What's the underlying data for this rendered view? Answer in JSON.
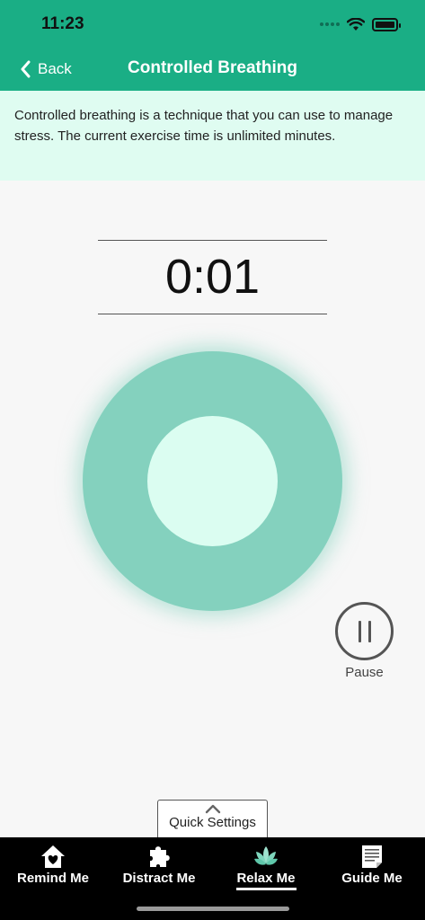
{
  "status_bar": {
    "time": "11:23"
  },
  "nav": {
    "back_label": "Back",
    "title": "Controlled Breathing"
  },
  "info": {
    "text": "Controlled breathing is a technique that you can use to manage stress. The current exercise time is unlimited minutes."
  },
  "timer": {
    "value": "0:01"
  },
  "controls": {
    "pause_label": "Pause",
    "quick_settings_label": "Quick Settings"
  },
  "tabs": [
    {
      "label": "Remind Me",
      "icon": "home-heart-icon",
      "selected": false
    },
    {
      "label": "Distract Me",
      "icon": "puzzle-icon",
      "selected": false
    },
    {
      "label": "Relax Me",
      "icon": "lotus-icon",
      "selected": true
    },
    {
      "label": "Guide Me",
      "icon": "document-icon",
      "selected": false
    }
  ],
  "colors": {
    "header": "#1aae85",
    "banner": "#dffcf1",
    "outer_circle": "#84d1be",
    "inner_circle": "#dbfdf1",
    "tabbar": "#000000"
  }
}
